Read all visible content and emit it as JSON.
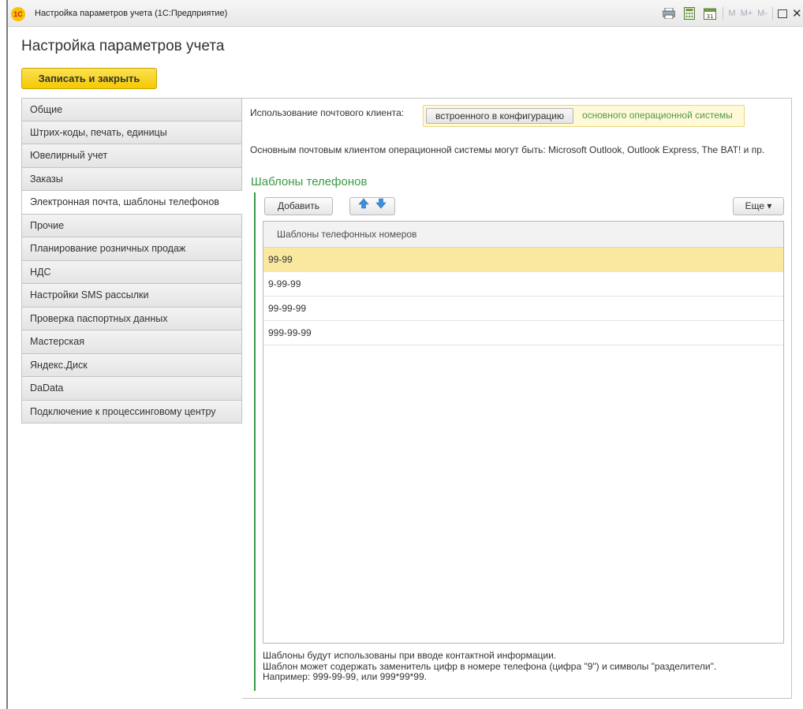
{
  "window": {
    "title": "Настройка параметров учета  (1С:Предприятие)",
    "logo_text": "1С",
    "toolbar": [
      "М",
      "М+",
      "М-"
    ]
  },
  "page": {
    "title": "Настройка параметров учета",
    "save_close_label": "Записать и закрыть"
  },
  "sidebar": {
    "items": [
      {
        "label": "Общие"
      },
      {
        "label": "Штрих-коды, печать, единицы"
      },
      {
        "label": "Ювелирный учет"
      },
      {
        "label": "Заказы"
      },
      {
        "label": "Электронная почта, шаблоны телефонов",
        "active": true
      },
      {
        "label": "Прочие"
      },
      {
        "label": "Планирование розничных продаж"
      },
      {
        "label": "НДС"
      },
      {
        "label": "Настройки SMS рассылки"
      },
      {
        "label": "Проверка паспортных данных"
      },
      {
        "label": "Мастерская"
      },
      {
        "label": "Яндекс.Диск"
      },
      {
        "label": "DaData"
      },
      {
        "label": "Подключение к процессинговому центру"
      }
    ]
  },
  "mail": {
    "label": "Использование почтового клиента:",
    "options": [
      {
        "label": "встроенного в конфигурацию",
        "selected": false
      },
      {
        "label": "основного операционной системы",
        "selected": true
      }
    ],
    "info": "Основным почтовым клиентом операционной системы  могут быть: Microsoft Outlook, Outlook Express, The BAT! и пр."
  },
  "phones": {
    "group_title": "Шаблоны телефонов",
    "add_label": "Добавить",
    "more_label": "Еще ▾",
    "column_header": "Шаблоны телефонных номеров",
    "rows": [
      {
        "value": "99-99",
        "selected": true
      },
      {
        "value": "9-99-99",
        "selected": false
      },
      {
        "value": "99-99-99",
        "selected": false
      },
      {
        "value": "999-99-99",
        "selected": false
      }
    ],
    "note": [
      "Шаблоны будут использованы при вводе контактной информации.",
      "Шаблон может содержать заменитель цифр в номере телефона (цифра \"9\") и символы \"разделители\".",
      "Например: 999-99-99, или 999*99*99."
    ]
  },
  "colors": {
    "accent_yellow": "#f5c900",
    "group_green": "#3a9a45",
    "selected_row": "#fbe8a0",
    "arrow_blue": "#3d8fd9"
  }
}
